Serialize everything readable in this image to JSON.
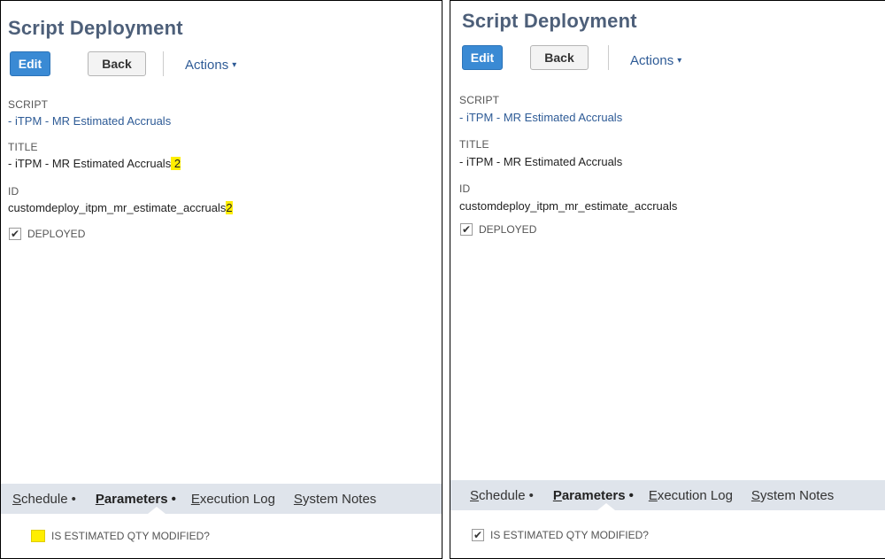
{
  "left": {
    "title": "Script Deployment",
    "buttons": {
      "edit": "Edit",
      "back": "Back",
      "actions": "Actions"
    },
    "fields": {
      "script_label": "SCRIPT",
      "script_value": "- iTPM - MR Estimated Accruals",
      "title_label": "TITLE",
      "title_value": "- iTPM - MR Estimated Accruals",
      "title_suffix": " 2",
      "id_label": "ID",
      "id_value": "customdeploy_itpm_mr_estimate_accruals",
      "id_suffix": "2",
      "deployed_label": "DEPLOYED",
      "deployed_checked": true
    },
    "tabs": {
      "schedule": {
        "first": "S",
        "rest": "chedule",
        "dot": "•"
      },
      "parameters": {
        "first": "P",
        "rest": "arameters",
        "dot": "•"
      },
      "execution_log": {
        "first": "E",
        "rest": "xecution Log"
      },
      "system_notes": {
        "first": "S",
        "rest": "ystem Notes"
      }
    },
    "parameter": {
      "label": "IS ESTIMATED QTY MODIFIED?",
      "checked": false,
      "highlighted": true
    }
  },
  "right": {
    "title": "Script Deployment",
    "buttons": {
      "edit": "Edit",
      "back": "Back",
      "actions": "Actions"
    },
    "fields": {
      "script_label": "SCRIPT",
      "script_value": "- iTPM - MR Estimated Accruals",
      "title_label": "TITLE",
      "title_value": "- iTPM - MR Estimated Accruals",
      "id_label": "ID",
      "id_value": "customdeploy_itpm_mr_estimate_accruals",
      "deployed_label": "DEPLOYED",
      "deployed_checked": true
    },
    "tabs": {
      "schedule": {
        "first": "S",
        "rest": "chedule",
        "dot": "•"
      },
      "parameters": {
        "first": "P",
        "rest": "arameters",
        "dot": "•"
      },
      "execution_log": {
        "first": "E",
        "rest": "xecution Log"
      },
      "system_notes": {
        "first": "S",
        "rest": "ystem Notes"
      }
    },
    "parameter": {
      "label": "IS ESTIMATED QTY MODIFIED?",
      "checked": true
    },
    "checkmark": "✔",
    "caret": "▾"
  }
}
